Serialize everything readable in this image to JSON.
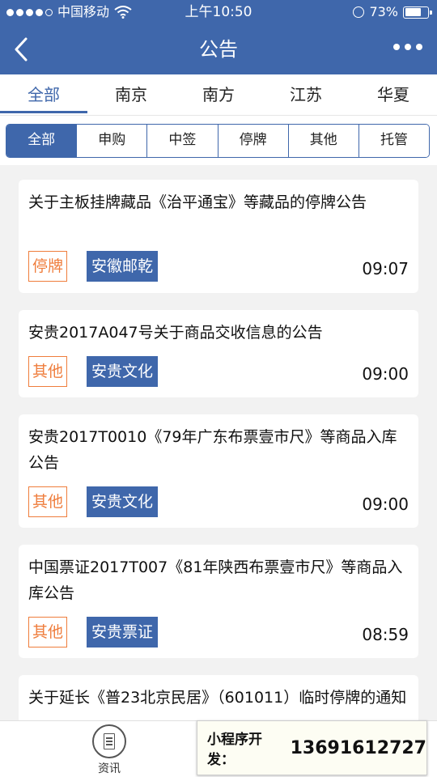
{
  "status_bar": {
    "carrier": "中国移动",
    "time": "上午10:50",
    "battery_percent": "73%",
    "battery_level": 0.73,
    "icons": [
      "signal-icon",
      "wifi-icon",
      "alarm-icon",
      "battery-icon"
    ]
  },
  "navbar": {
    "title": "公告",
    "back_icon": "chevron-left-icon",
    "more_icon": "more-dots-icon"
  },
  "tabs": [
    {
      "label": "全部",
      "active": true
    },
    {
      "label": "南京",
      "active": false
    },
    {
      "label": "南方",
      "active": false
    },
    {
      "label": "江苏",
      "active": false
    },
    {
      "label": "华夏",
      "active": false
    }
  ],
  "filters": [
    {
      "label": "全部",
      "active": true
    },
    {
      "label": "申购",
      "active": false
    },
    {
      "label": "中签",
      "active": false
    },
    {
      "label": "停牌",
      "active": false
    },
    {
      "label": "其他",
      "active": false
    },
    {
      "label": "托管",
      "active": false
    }
  ],
  "announcements": [
    {
      "title": "关于主板挂牌藏品《治平通宝》等藏品的停牌公告",
      "type": "停牌",
      "org": "安徽邮乾",
      "time": "09:07"
    },
    {
      "title": "安贵2017A047号关于商品交收信息的公告",
      "type": "其他",
      "org": "安贵文化",
      "time": "09:00"
    },
    {
      "title": "安贵2017T0010《79年广东布票壹市尺》等商品入库公告",
      "type": "其他",
      "org": "安贵文化",
      "time": "09:00"
    },
    {
      "title": "中国票证2017T007《81年陕西布票壹市尺》等商品入库公告",
      "type": "其他",
      "org": "安贵票证",
      "time": "08:59"
    },
    {
      "title": "关于延长《普23北京民居》（601011）临时停牌的通知",
      "type": "",
      "org": "",
      "time": ""
    }
  ],
  "bottom_nav": {
    "news_label": "资讯",
    "news_icon": "news-document-icon"
  },
  "promo": {
    "label": "小程序开发：",
    "phone": "13691612727"
  },
  "colors": {
    "primary": "#3f67ab",
    "tag_orange": "#ef7d3c",
    "background": "#f2f2f2"
  }
}
